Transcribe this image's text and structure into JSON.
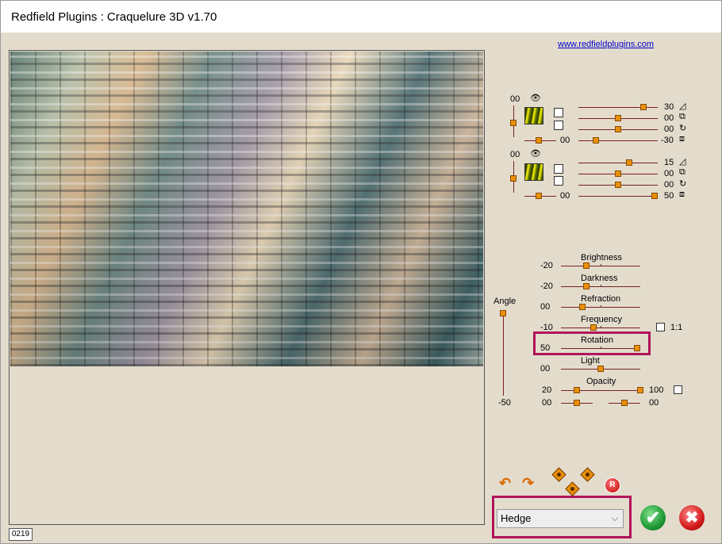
{
  "window": {
    "title": "Redfield Plugins : Craquelure 3D  v1.70"
  },
  "link": "www.redfieldplugins.com",
  "status": "0219",
  "layer1": {
    "value_top": "00",
    "rows": [
      {
        "value": "30",
        "level": 0.85
      },
      {
        "value": "00",
        "level": 0.5
      },
      {
        "value": "00",
        "level": 0.5
      },
      {
        "value": "-30",
        "level": 0.2
      }
    ],
    "left_value": "00"
  },
  "layer2": {
    "value_top": "00",
    "rows": [
      {
        "value": "15",
        "level": 0.65
      },
      {
        "value": "00",
        "level": 0.5
      },
      {
        "value": "00",
        "level": 0.5
      },
      {
        "value": "50",
        "level": 1.0
      }
    ],
    "left_value": "00"
  },
  "angle": {
    "label": "Angle",
    "value": "-50",
    "level": 0.0
  },
  "params": [
    {
      "label": "Brightness",
      "value": "-20",
      "level": 0.3
    },
    {
      "label": "Darkness",
      "value": "-20",
      "level": 0.3
    },
    {
      "label": "Refraction",
      "value": "00",
      "level": 0.25
    },
    {
      "label": "Frequency",
      "value": "-10",
      "level": 0.4
    },
    {
      "label": "Rotation",
      "value": "50",
      "level": 1.0
    },
    {
      "label": "Light",
      "value": "00",
      "level": 0.5
    }
  ],
  "ratio_label": "1:1",
  "opacity": {
    "label": "Opacity",
    "left_value": "20",
    "right_value": "100",
    "bottom_left": "00",
    "bottom_right": "00"
  },
  "preset": {
    "selected": "Hedge"
  },
  "buttons": {
    "reset": "R"
  },
  "colors": {
    "accent": "#b0135a",
    "knob": "#e8900a",
    "ok": "#1f9a35",
    "cancel": "#d31a1a"
  }
}
